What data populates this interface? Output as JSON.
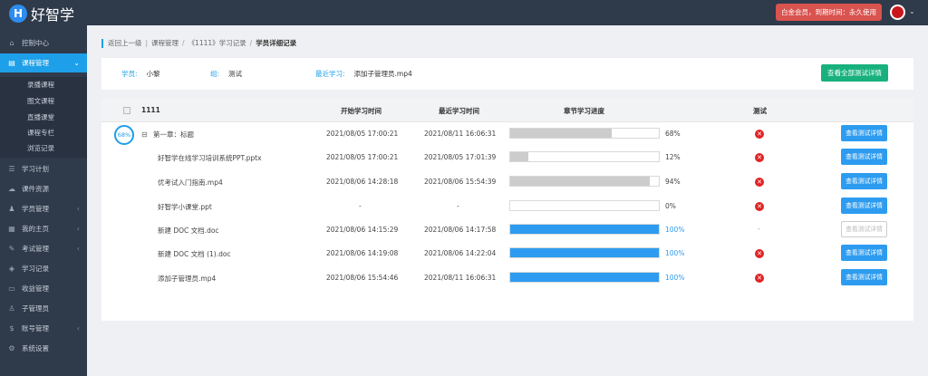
{
  "logo": {
    "badge": "H",
    "text": "好智学"
  },
  "header": {
    "vip_text": "白金会员，到期时间：永久使用"
  },
  "sidebar": {
    "items": [
      {
        "label": "控制中心",
        "icon": "home-icon"
      },
      {
        "label": "课程管理",
        "icon": "book-icon"
      },
      {
        "label": "学习计划",
        "icon": "plan-icon"
      },
      {
        "label": "课件资源",
        "icon": "cloud-icon"
      },
      {
        "label": "学员管理",
        "icon": "users-icon"
      },
      {
        "label": "我的主页",
        "icon": "page-icon"
      },
      {
        "label": "考试管理",
        "icon": "exam-icon"
      },
      {
        "label": "学习记录",
        "icon": "record-icon"
      },
      {
        "label": "收益管理",
        "icon": "wallet-icon"
      },
      {
        "label": "子管理员",
        "icon": "admin-icon"
      },
      {
        "label": "账号管理",
        "icon": "dollar-icon"
      },
      {
        "label": "系统设置",
        "icon": "gear-icon"
      }
    ],
    "subitems": [
      "录播课程",
      "图文课程",
      "直播课堂",
      "课程专栏",
      "浏览记录"
    ]
  },
  "breadcrumb": {
    "back": "返回上一级",
    "course": "课程管理",
    "record": "《1111》学习记录",
    "current": "学员详细记录"
  },
  "info": {
    "student_label": "学员:",
    "student_value": "小黎",
    "group_label": "组:",
    "group_value": "测试",
    "recent_label": "最近学习:",
    "recent_value": "添加子管理员.mp4",
    "view_all_button": "查看全部测试详情"
  },
  "table": {
    "headers": {
      "name": "1111",
      "start": "开始学习时间",
      "recent": "最近学习时间",
      "progress": "章节学习进度",
      "test": "测试"
    },
    "chapter_progress": "68%",
    "view_button": "查看测试详情",
    "rows": [
      {
        "name": "第一章：标题",
        "start": "2021/08/05 17:00:21",
        "recent": "2021/08/11 16:06:31",
        "progress": 68,
        "pct": "68%",
        "test": "x",
        "btn_disabled": false,
        "chapter": true
      },
      {
        "name": "好智学在线学习培训系统PPT.pptx",
        "start": "2021/08/05 17:00:21",
        "recent": "2021/08/05 17:01:39",
        "progress": 12,
        "pct": "12%",
        "test": "x",
        "btn_disabled": false
      },
      {
        "name": "优考试入门指南.mp4",
        "start": "2021/08/06 14:28:18",
        "recent": "2021/08/06 15:54:39",
        "progress": 94,
        "pct": "94%",
        "test": "x",
        "btn_disabled": false
      },
      {
        "name": "好智学小课堂.ppt",
        "start": "-",
        "recent": "-",
        "progress": 0,
        "pct": "0%",
        "test": "x",
        "btn_disabled": false
      },
      {
        "name": "新建 DOC 文档.doc",
        "start": "2021/08/06 14:15:29",
        "recent": "2021/08/06 14:17:58",
        "progress": 100,
        "pct": "100%",
        "test": "-",
        "btn_disabled": true
      },
      {
        "name": "新建 DOC 文档 (1).doc",
        "start": "2021/08/06 14:19:08",
        "recent": "2021/08/06 14:22:04",
        "progress": 100,
        "pct": "100%",
        "test": "x",
        "btn_disabled": false
      },
      {
        "name": "添加子管理员.mp4",
        "start": "2021/08/06 15:54:46",
        "recent": "2021/08/11 16:06:31",
        "progress": 100,
        "pct": "100%",
        "test": "x",
        "btn_disabled": false
      }
    ]
  },
  "colors": {
    "accent": "#1e9fe9",
    "complete": "#2d9cf0",
    "partial": "#cccccc",
    "error": "#e02424",
    "success_button": "#18b17d"
  }
}
